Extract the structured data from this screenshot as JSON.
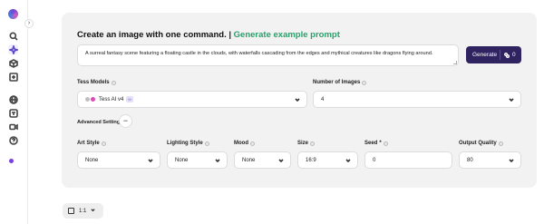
{
  "sidebar": {
    "icons": [
      "search-icon",
      "sparkle-icon",
      "box-icon",
      "image-plus-icon",
      "globe-icon",
      "translate-icon",
      "video-icon",
      "help-icon"
    ],
    "accent": "#7a3fe0"
  },
  "header": {
    "title": "Create an image with one command.",
    "separator": "|",
    "link": "Generate example prompt",
    "link_color": "#2e9e6b"
  },
  "prompt": {
    "value": "A surreal fantasy scene featuring a floating castle in the clouds, with waterfalls cascading from the edges and mythical creatures like dragons flying around."
  },
  "generate": {
    "label": "Generate",
    "credits": "0",
    "bg_color": "#2f2360"
  },
  "models": {
    "label": "Tess Models",
    "selected": "Tess AI v4",
    "badge": "∞"
  },
  "images": {
    "label": "Number of Images",
    "value": "4"
  },
  "advanced": {
    "label": "Advanced Settings",
    "toggle": "−"
  },
  "art_style": {
    "label": "Art Style",
    "value": "None"
  },
  "lighting": {
    "label": "Lighting Style",
    "value": "None"
  },
  "mood": {
    "label": "Mood",
    "value": "None"
  },
  "size": {
    "label": "Size",
    "value": "16:9"
  },
  "seed": {
    "label": "Seed",
    "required": "*",
    "value": "0"
  },
  "quality": {
    "label": "Output Quality",
    "value": "80"
  },
  "ratio": {
    "value": "1:1"
  }
}
